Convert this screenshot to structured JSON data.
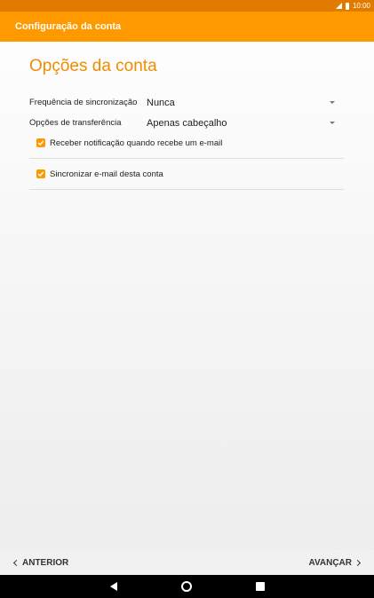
{
  "status_bar": {
    "time": "10:00"
  },
  "app_bar": {
    "title": "Configuração da conta"
  },
  "page": {
    "title": "Opções da conta"
  },
  "settings": [
    {
      "label": "Frequência de sincronização",
      "value": "Nunca"
    },
    {
      "label": "Opções de transferência",
      "value": "Apenas cabeçalho"
    }
  ],
  "checkboxes": [
    {
      "label": "Receber notificação quando recebe um e-mail",
      "checked": true
    },
    {
      "label": "Sincronizar e-mail desta conta",
      "checked": true
    }
  ],
  "bottom_nav": {
    "back_label": "ANTERIOR",
    "next_label": "AVANÇAR"
  },
  "colors": {
    "accent": "#ff9900",
    "status_bar": "#e07b00",
    "title": "#f08c00"
  }
}
